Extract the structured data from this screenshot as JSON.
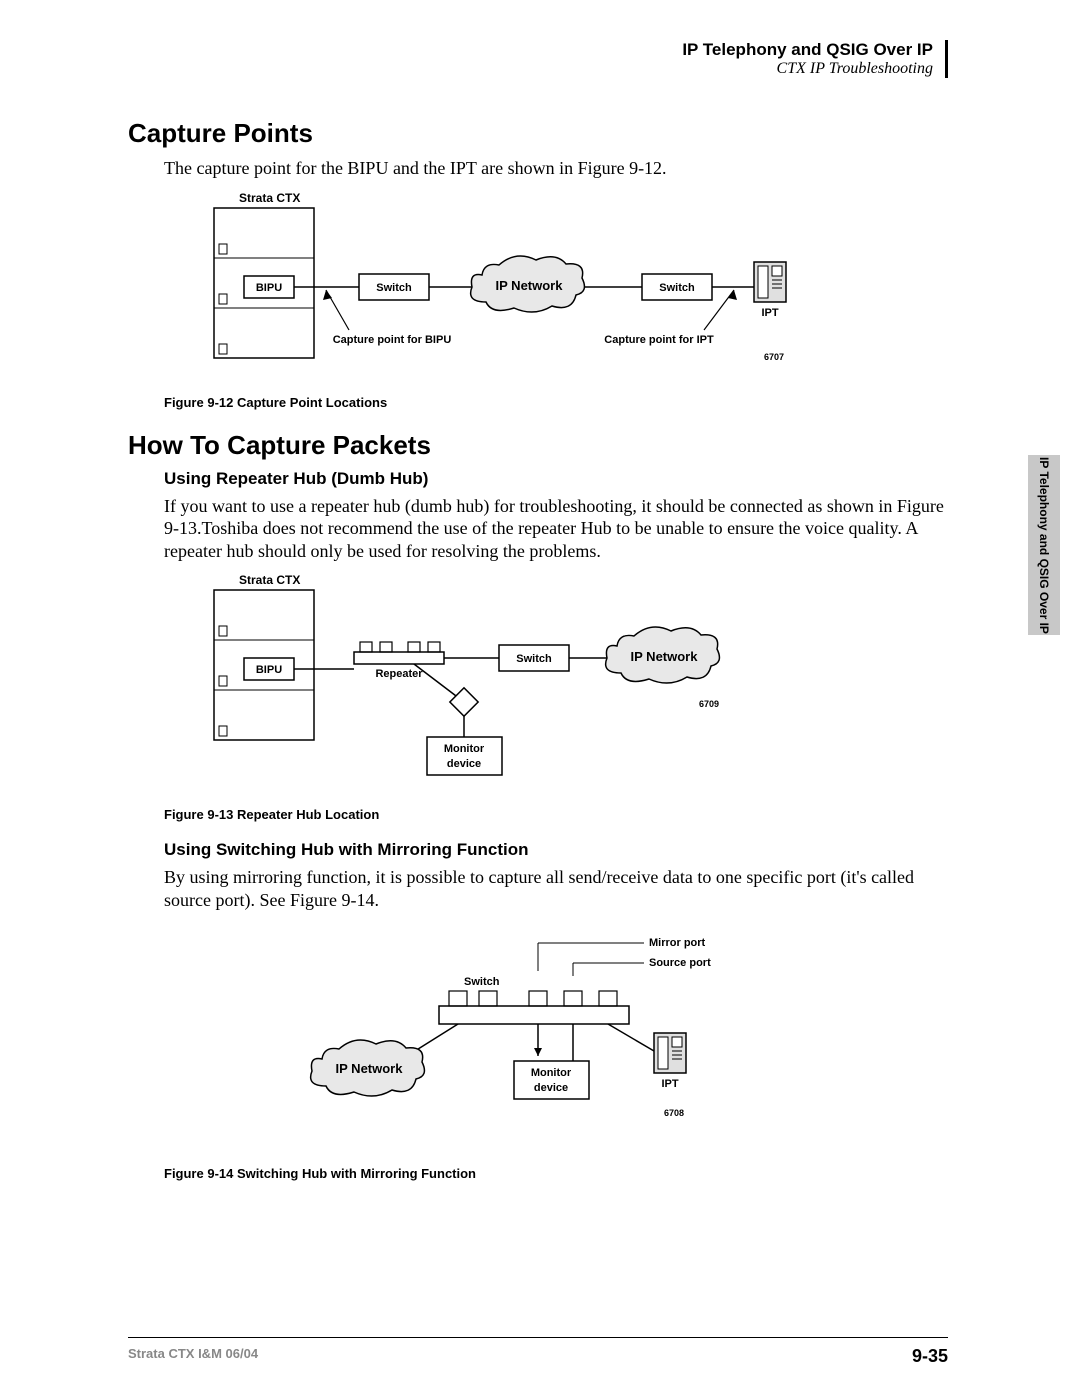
{
  "header": {
    "line1": "IP Telephony and QSIG Over IP",
    "line2": "CTX IP Troubleshooting"
  },
  "section1": {
    "title": "Capture Points",
    "body": "The capture point for the BIPU and the IPT are shown in Figure 9-12."
  },
  "fig12": {
    "caption": "Figure 9-12   Capture Point Locations",
    "labels": {
      "strata": "Strata CTX",
      "bipu": "BIPU",
      "switch1": "Switch",
      "ipnetwork": "IP Network",
      "switch2": "Switch",
      "ipt": "IPT",
      "cap_bipu": "Capture point for BIPU",
      "cap_ipt": "Capture point for IPT",
      "id": "6707"
    }
  },
  "section2": {
    "title": "How To Capture Packets",
    "sub1": {
      "title": "Using Repeater Hub (Dumb Hub)",
      "body": "If you want to use a repeater hub (dumb hub) for troubleshooting, it should be connected as shown in Figure 9-13.Toshiba does not recommend the use of the repeater Hub to be unable to ensure the voice quality. A repeater hub should only be used for resolving the problems."
    },
    "sub2": {
      "title": "Using Switching Hub with Mirroring Function",
      "body": "By using mirroring function, it is possible to capture all send/receive data to one specific port (it's called source port). See Figure 9-14."
    }
  },
  "fig13": {
    "caption": "Figure 9-13   Repeater Hub Location",
    "labels": {
      "strata": "Strata CTX",
      "bipu": "BIPU",
      "repeater": "Repeater",
      "switch": "Switch",
      "ipnetwork": "IP Network",
      "monitor": "Monitor",
      "device": "device",
      "id": "6709"
    }
  },
  "fig14": {
    "caption": "Figure 9-14   Switching Hub with Mirroring Function",
    "labels": {
      "mirror": "Mirror port",
      "source": "Source port",
      "switch": "Switch",
      "ipnetwork": "IP Network",
      "monitor": "Monitor",
      "device": "device",
      "ipt": "IPT",
      "id": "6708"
    }
  },
  "sidetab": "IP Telephony and QSIG Over IP",
  "footer": {
    "left": "Strata CTX I&M      06/04",
    "right": "9-35"
  }
}
